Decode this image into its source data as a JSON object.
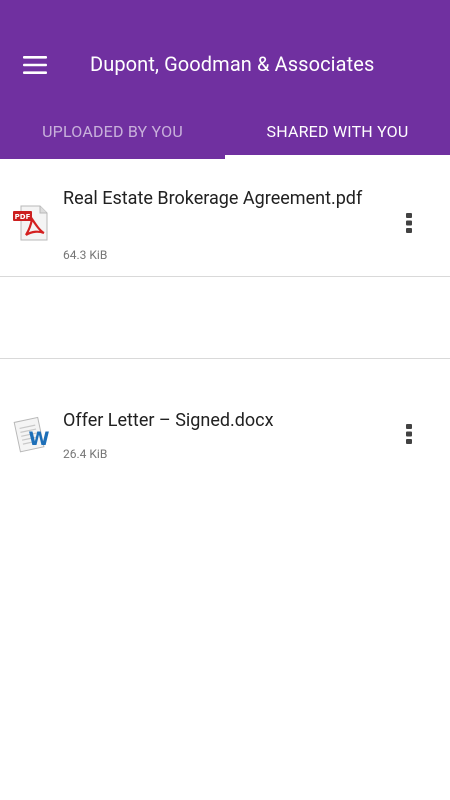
{
  "app_bar": {
    "menu_icon": "hamburger-menu-icon",
    "title": "Dupont, Goodman & Associates",
    "color": "#7030a0"
  },
  "tabs": [
    {
      "label": "UPLOADED BY YOU",
      "selected": false
    },
    {
      "label": "SHARED WITH YOU",
      "selected": true
    }
  ],
  "files": [
    {
      "name": "Real Estate Brokerage Agreement.pdf",
      "size": "64.3 KiB",
      "icon": "pdf-file-icon"
    },
    {
      "name": "Offer Letter – Signed.docx",
      "size": "26.4 KiB",
      "icon": "word-file-icon"
    }
  ],
  "row_menu_icon": "more-vert-icon"
}
